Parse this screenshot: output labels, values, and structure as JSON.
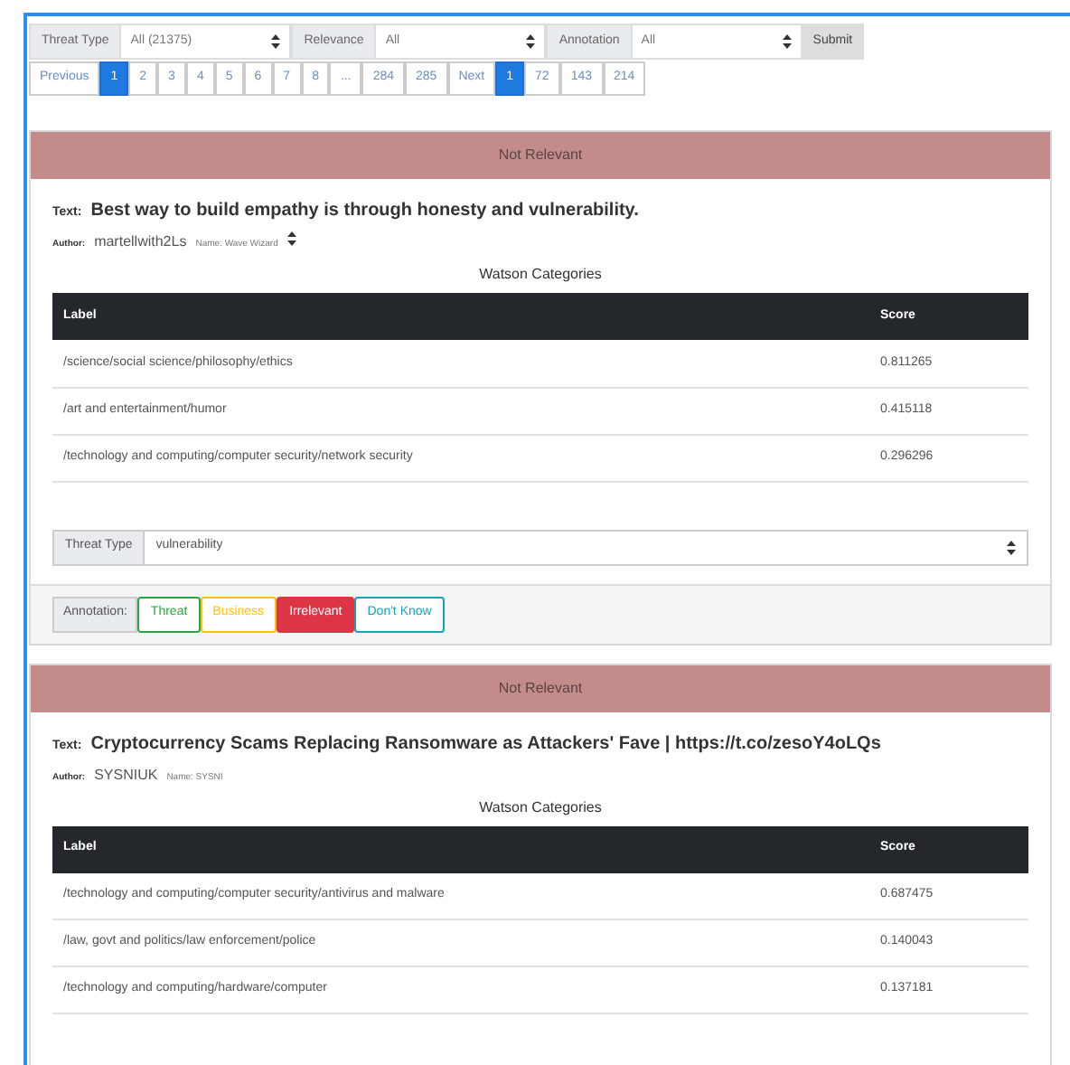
{
  "filters": [
    {
      "label": "Threat Type",
      "value": "All (21375)"
    },
    {
      "label": "Relevance",
      "value": "All"
    },
    {
      "label": "Annotation",
      "value": "All"
    }
  ],
  "submit": "Submit",
  "pagination": [
    {
      "label": "Previous",
      "selected": false
    },
    {
      "label": "1",
      "selected": true
    },
    {
      "label": "2",
      "selected": false
    },
    {
      "label": "3",
      "selected": false
    },
    {
      "label": "4",
      "selected": false
    },
    {
      "label": "5",
      "selected": false
    },
    {
      "label": "6",
      "selected": false
    },
    {
      "label": "7",
      "selected": false
    },
    {
      "label": "8",
      "selected": false
    },
    {
      "label": "...",
      "selected": false
    },
    {
      "label": "284",
      "selected": false
    },
    {
      "label": "285",
      "selected": false
    },
    {
      "label": "Next",
      "selected": false
    }
  ],
  "pagination_2": [
    {
      "label": "1",
      "selected": true
    },
    {
      "label": "72",
      "selected": false
    },
    {
      "label": "143",
      "selected": false
    },
    {
      "label": "214",
      "selected": false
    }
  ],
  "cards": [
    {
      "status": "Not Relevant",
      "text_label": "Text:",
      "text": "Best way to build empathy is through honesty and vulnerability.",
      "author_label": "Author:",
      "author": "martellwith2Ls",
      "name": "Name: Wave Wizard",
      "name_sort": true,
      "categories_title": "Watson Categories",
      "columns": [
        "Label",
        "Score"
      ],
      "rows": [
        {
          "label": "/science/social science/philosophy/ethics",
          "score": "0.811265"
        },
        {
          "label": "/art and entertainment/humor",
          "score": "0.415118"
        },
        {
          "label": "/technology and computing/computer security/network security",
          "score": "0.296296"
        }
      ],
      "threat_type": {
        "label": "Threat Type",
        "value": "vulnerability"
      },
      "annotation": {
        "label": "Annotation:",
        "buttons": [
          {
            "label": "Threat",
            "color": "#28a745",
            "selected": false
          },
          {
            "label": "Business",
            "color": "#ffc107",
            "selected": false
          },
          {
            "label": "Irrelevant",
            "color": "#dc3545",
            "selected": true
          },
          {
            "label": "Don't Know",
            "color": "#17a2b8",
            "selected": false
          }
        ]
      }
    },
    {
      "status": "Not Relevant",
      "text_label": "Text:",
      "text": "Cryptocurrency Scams Replacing Ransomware as Attackers' Fave | https://t.co/zesoY4oLQs",
      "author_label": "Author:",
      "author": "SYSNIUK",
      "name": "Name: SYSNI",
      "name_sort": false,
      "categories_title": "Watson Categories",
      "columns": [
        "Label",
        "Score"
      ],
      "rows": [
        {
          "label": "/technology and computing/computer security/antivirus and malware",
          "score": "0.687475"
        },
        {
          "label": "/law, govt and politics/law enforcement/police",
          "score": "0.140043"
        },
        {
          "label": "/technology and computing/hardware/computer",
          "score": "0.137181"
        }
      ]
    }
  ]
}
